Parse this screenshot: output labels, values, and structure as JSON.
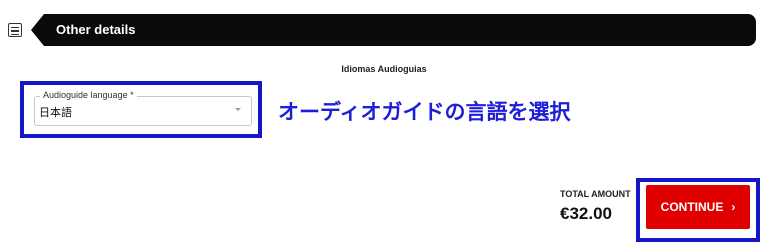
{
  "header": {
    "title": "Other details"
  },
  "section": {
    "heading": "Idiomas Audioguias"
  },
  "language_field": {
    "label": "Audioguide language *",
    "value": "日本語"
  },
  "annotation": "オーディオガイドの言語を選択",
  "total": {
    "label": "TOTAL AMOUNT",
    "amount": "€32.00"
  },
  "continue": {
    "label": "CONTINUE",
    "chevron": "›"
  },
  "colors": {
    "header_bg": "#0a0a0a",
    "highlight": "#1616c8",
    "annotation": "#1e1ed8",
    "button_bg": "#e00000"
  },
  "icons": [
    "menu-icon",
    "caret-down-icon",
    "chevron-right-icon"
  ]
}
